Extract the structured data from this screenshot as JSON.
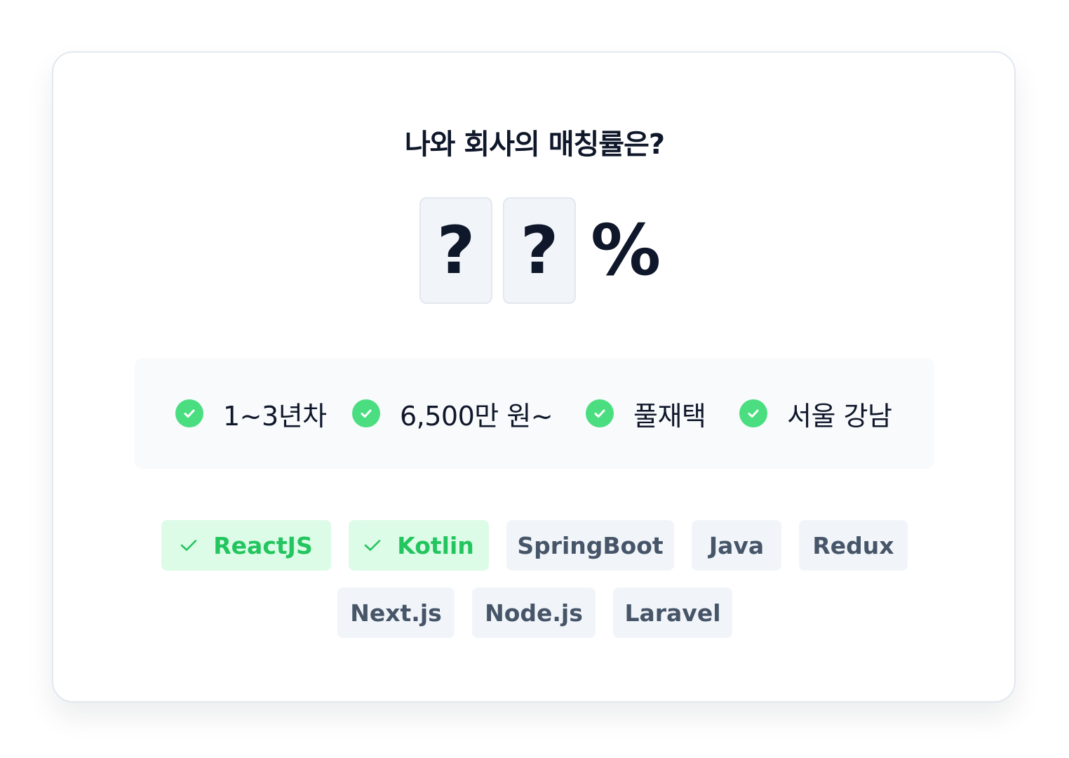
{
  "card": {
    "title": "나와 회사의 매칭률은?",
    "score": {
      "digits": [
        "?",
        "?"
      ],
      "unit": "%"
    },
    "conditions": [
      {
        "label": "1~3년차",
        "icon": "check-circle-icon"
      },
      {
        "label": "6,500만 원~",
        "icon": "check-circle-icon"
      },
      {
        "label": "풀재택",
        "icon": "check-circle-icon"
      },
      {
        "label": "서울 강남",
        "icon": "check-circle-icon"
      }
    ],
    "skills": [
      {
        "label": "ReactJS",
        "matched": true
      },
      {
        "label": "Kotlin",
        "matched": true
      },
      {
        "label": "SpringBoot",
        "matched": false
      },
      {
        "label": "Java",
        "matched": false
      },
      {
        "label": "Redux",
        "matched": false
      },
      {
        "label": "Next.js",
        "matched": false
      },
      {
        "label": "Node.js",
        "matched": false
      },
      {
        "label": "Laravel",
        "matched": false
      }
    ]
  },
  "colors": {
    "accent_green": "#22c55e",
    "check_green": "#4ade80",
    "matched_bg": "#dcfce7",
    "tag_bg": "#f1f5f9",
    "text_dark": "#0f172a",
    "tag_text": "#475569"
  }
}
